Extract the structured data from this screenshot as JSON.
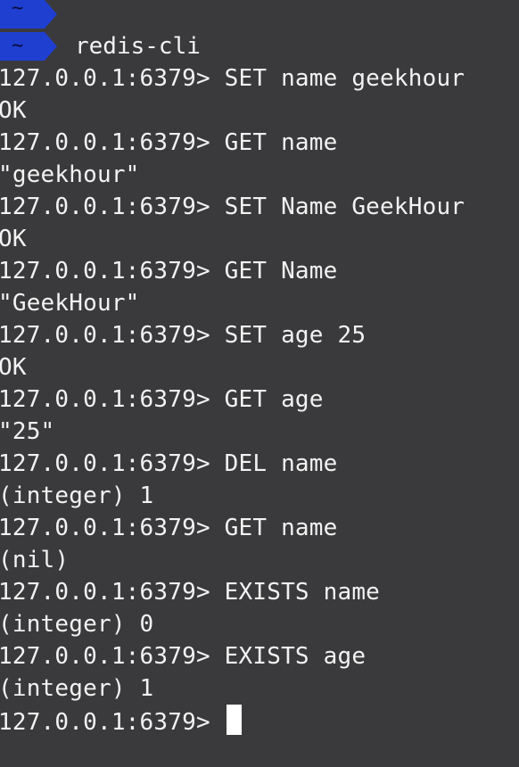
{
  "prompt_segments": [
    {
      "symbol": "~",
      "color": "#1f3fd1"
    },
    {
      "symbol": "~",
      "color": "#1f3fd1"
    }
  ],
  "launch_command": "redis-cli",
  "lines": [
    "127.0.0.1:6379> SET name geekhour",
    "OK",
    "127.0.0.1:6379> GET name",
    "\"geekhour\"",
    "127.0.0.1:6379> SET Name GeekHour",
    "OK",
    "127.0.0.1:6379> GET Name",
    "\"GeekHour\"",
    "127.0.0.1:6379> SET age 25",
    "OK",
    "127.0.0.1:6379> GET age",
    "\"25\"",
    "127.0.0.1:6379> DEL name",
    "(integer) 1",
    "127.0.0.1:6379> GET name",
    "(nil)",
    "127.0.0.1:6379> EXISTS name",
    "(integer) 0",
    "127.0.0.1:6379> EXISTS age",
    "(integer) 1"
  ],
  "current_prompt": "127.0.0.1:6379> ",
  "colors": {
    "background": "#3a3a3c",
    "foreground": "#f2f2f2",
    "segment": "#1f3fd1",
    "cursor": "#ffffff"
  }
}
